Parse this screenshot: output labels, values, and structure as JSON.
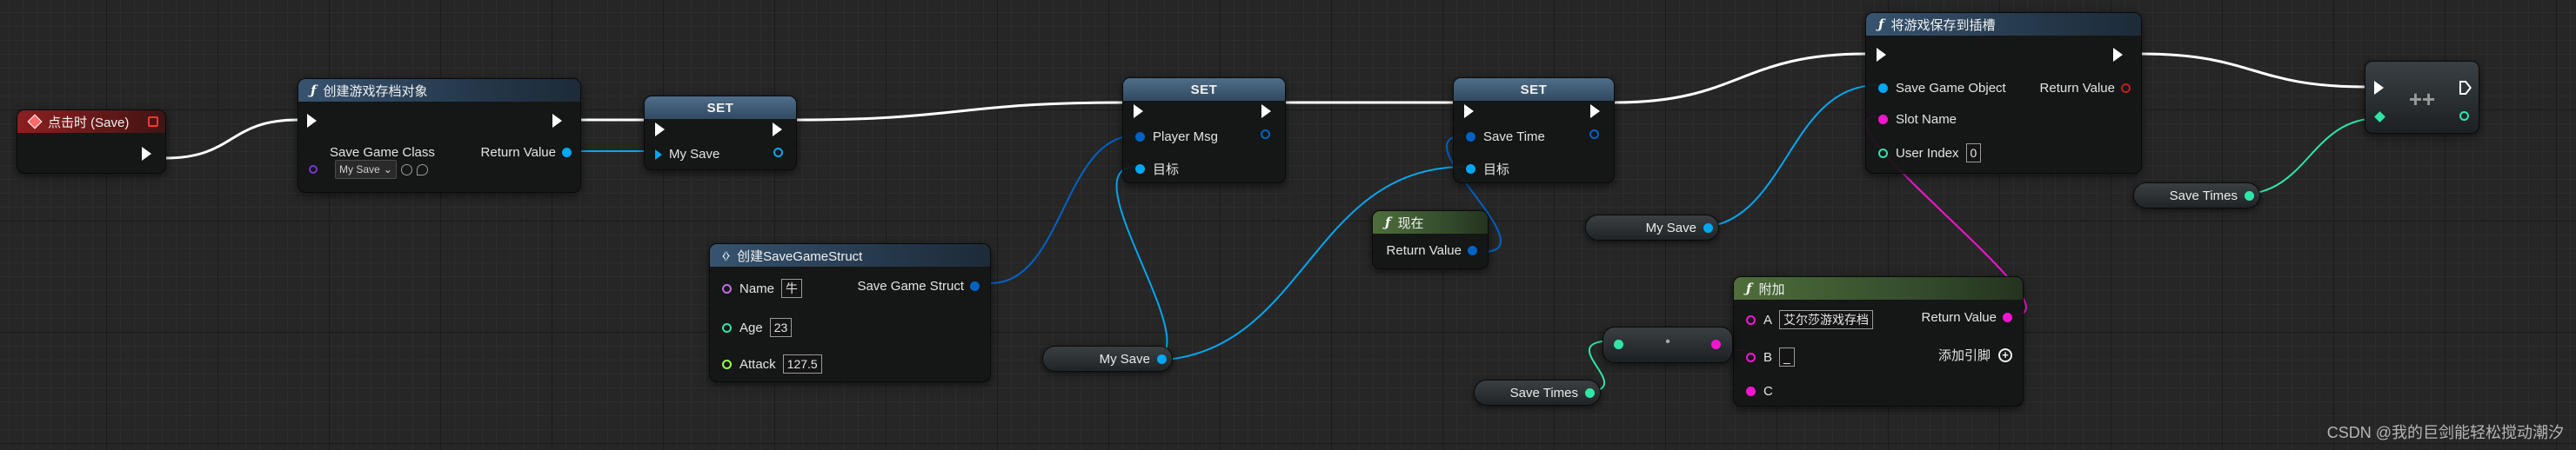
{
  "colors": {
    "exec": "#ffffff",
    "object": "#00a8f2",
    "string": "#f515d1",
    "integer": "#2ee6a8",
    "struct": "#0063c4",
    "float": "#9aff4c",
    "class": "#7a37c7",
    "delegate": "#ff3333"
  },
  "event_node": {
    "title": "点击时 (Save)"
  },
  "create_save": {
    "title": "创建游戏存档对象",
    "class_label": "Save Game Class",
    "class_value": "My Save",
    "return_label": "Return Value"
  },
  "set1": {
    "title": "SET",
    "var_label": "My Save"
  },
  "set2": {
    "title": "SET",
    "var_label": "Player Msg",
    "target_label": "目标"
  },
  "set3": {
    "title": "SET",
    "var_label": "Save Time",
    "target_label": "目标"
  },
  "save_slot": {
    "title": "将游戏保存到插槽",
    "object_label": "Save Game Object",
    "slot_label": "Slot Name",
    "index_label": "User Index",
    "index_value": "0",
    "return_label": "Return Value"
  },
  "increment": {
    "title": "++"
  },
  "now_node": {
    "title": "现在",
    "return_label": "Return Value"
  },
  "make_struct": {
    "title": "创建SaveGameStruct",
    "name_label": "Name",
    "name_value": "牛",
    "age_label": "Age",
    "age_value": "23",
    "attack_label": "Attack",
    "attack_value": "127.5",
    "output_label": "Save Game Struct"
  },
  "append": {
    "title": "附加",
    "a_label": "A",
    "a_value": "艾尔莎游戏存档",
    "b_label": "B",
    "b_value": "_",
    "c_label": "C",
    "return_label": "Return Value",
    "add_pin_label": "添加引脚"
  },
  "to_string": {
    "title": "•"
  },
  "getters": {
    "my_save_1": "My Save",
    "my_save_2": "My Save",
    "save_times_1": "Save Times",
    "save_times_2": "Save Times"
  },
  "watermark": "CSDN @我的巨剑能轻松搅动潮汐"
}
